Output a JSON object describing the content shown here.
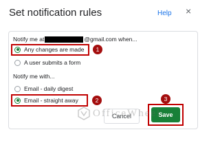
{
  "dialog": {
    "title": "Set notification rules",
    "help_label": "Help",
    "close_glyph": "×"
  },
  "notify_when": {
    "prefix": "Notify me at",
    "email_suffix": "@gmail.com when...",
    "options": [
      {
        "label": "Any changes are made",
        "selected": true
      },
      {
        "label": "A user submits a form",
        "selected": false
      }
    ]
  },
  "notify_with": {
    "heading": "Notify me with...",
    "options": [
      {
        "label": "Email - daily digest",
        "selected": false
      },
      {
        "label": "Email - straight away",
        "selected": true
      }
    ]
  },
  "buttons": {
    "cancel_label": "Cancel",
    "save_label": "Save"
  },
  "annotations": {
    "step_1": "1",
    "step_2": "2",
    "step_3": "3",
    "highlight_color": "#c00000"
  },
  "watermark": {
    "text": "OfficeWheel",
    "icon": "officewheel-logo-icon"
  },
  "colors": {
    "accent": "#188038",
    "link": "#1a73e8"
  }
}
